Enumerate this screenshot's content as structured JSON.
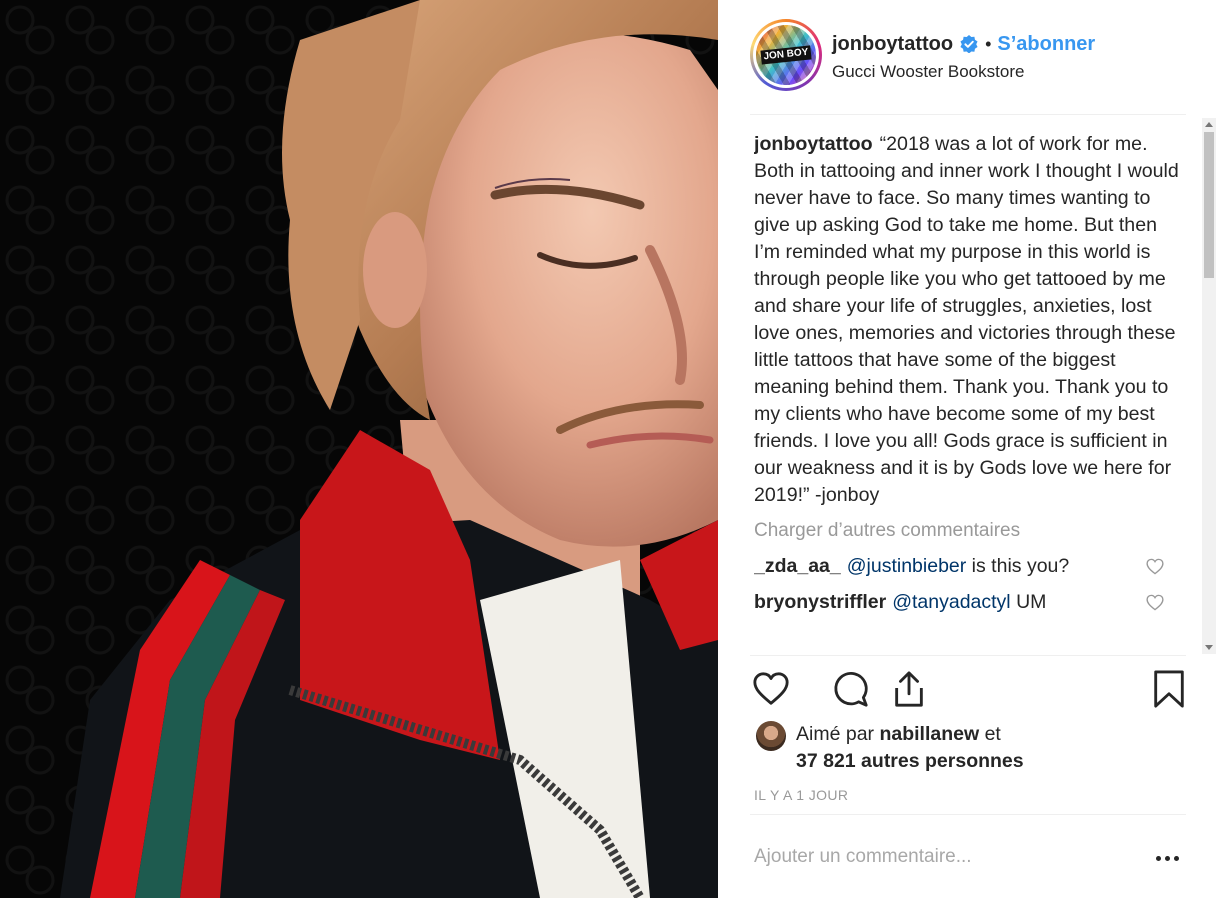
{
  "post": {
    "username": "jonboytattoo",
    "follow_label": "S’abonner",
    "separator": "•",
    "location": "Gucci Wooster Bookstore",
    "avatar_text": "JON BOY",
    "caption_username": "jonboytattoo",
    "caption_text": "“2018 was a lot of work for me. Both in tattooing and inner work I thought I would never have to face. So many times wanting to give up asking God to take me home. But then I’m reminded what my purpose in this world is through people like you who get tattooed by me and share your life of struggles, anxieties, lost love ones, memories and victories through these little tattoos that have some of the biggest meaning behind them. Thank you. Thank you to my clients who have become some of my best friends. I love you all! Gods grace is sufficient in our weakness and it is by Gods love we here for 2019!” -jonboy",
    "load_more_label": "Charger d’autres commentaires",
    "comments": [
      {
        "user": "_zda_aa_",
        "mention": "@justinbieber",
        "text": " is this you?"
      },
      {
        "user": "bryonystriffler",
        "mention": "@tanyadactyl",
        "text": " UM"
      }
    ],
    "likes": {
      "prefix": "Aimé par ",
      "first_user": "nabillanew",
      "joiner": " et",
      "others": "37 821 autres personnes"
    },
    "timestamp": "IL Y A 1 JOUR",
    "add_comment_placeholder": "Ajouter un commentaire..."
  },
  "icons": {
    "verified": "verified-badge-icon",
    "like": "heart-icon",
    "comment": "comment-icon",
    "share": "share-icon",
    "save": "bookmark-icon",
    "more": "more-options-icon",
    "comment_like": "heart-icon"
  },
  "colors": {
    "link_blue": "#3897f0",
    "mention_blue": "#003569",
    "muted": "#999999",
    "text": "#262626"
  }
}
